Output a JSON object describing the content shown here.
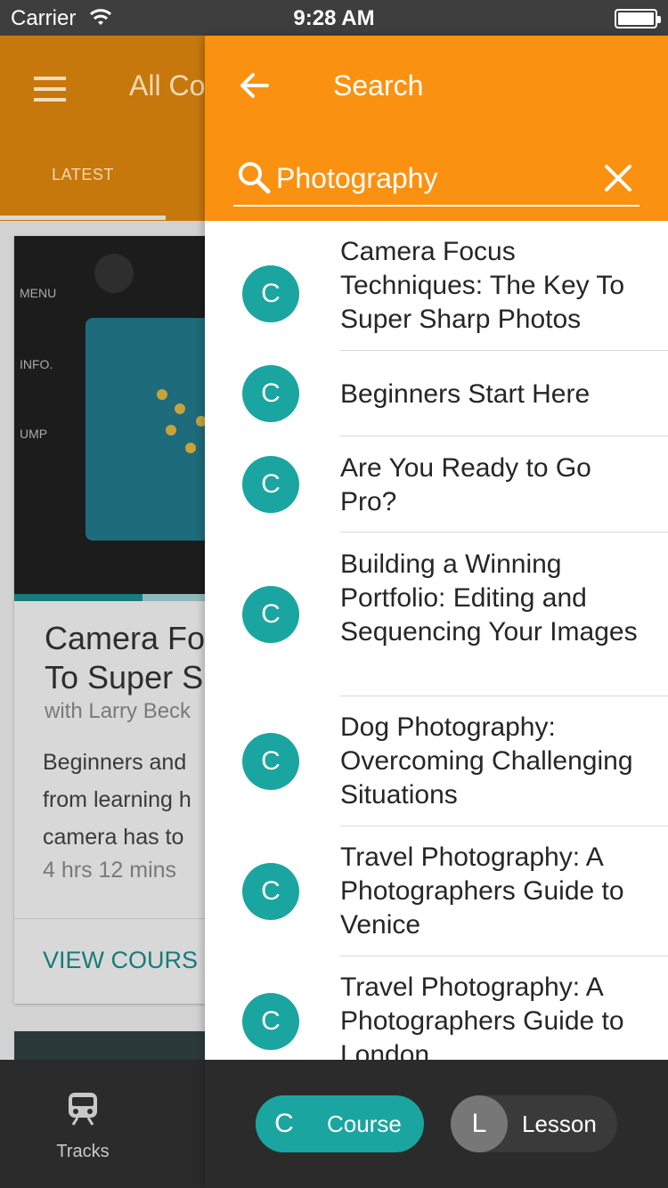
{
  "status": {
    "carrier": "Carrier",
    "time": "9:28 AM"
  },
  "background": {
    "title": "All Co",
    "tab_latest": "LATEST",
    "card": {
      "title": "Camera Fo\nTo Super S",
      "author": "with Larry Beck",
      "description": "Beginners and\nfrom learning h\ncamera has to",
      "duration": "4 hrs 12 mins",
      "view_label": "VIEW COURS",
      "progress": 0.48
    },
    "bottom_nav": {
      "tracks_label": "Tracks",
      "tracks_icon": "train-icon"
    }
  },
  "search_panel": {
    "title": "Search",
    "back_icon": "arrow-left-icon",
    "search_icon": "magnifier-icon",
    "clear_icon": "close-icon",
    "query": "Photography",
    "results": [
      {
        "badge": "C",
        "title": "Camera Focus Techniques: The Key To Super Sharp Photos"
      },
      {
        "badge": "C",
        "title": "Beginners Start Here"
      },
      {
        "badge": "C",
        "title": "Are You Ready to Go Pro?"
      },
      {
        "badge": "C",
        "title": "Building a Winning Portfolio: Editing and Sequencing Your Images"
      },
      {
        "badge": "C",
        "title": "Dog Photography: Overcoming Challenging Situations"
      },
      {
        "badge": "C",
        "title": "Travel Photography: A Photographers Guide to Venice"
      },
      {
        "badge": "C",
        "title": "Travel Photography: A Photographers Guide to London"
      }
    ],
    "filters": {
      "course": {
        "badge": "C",
        "label": "Course",
        "color": "#1aa5a1"
      },
      "lesson": {
        "badge": "L",
        "label": "Lesson",
        "color": "#777777"
      }
    }
  },
  "colors": {
    "accent": "#fb9110",
    "teal": "#1aa5a1"
  }
}
